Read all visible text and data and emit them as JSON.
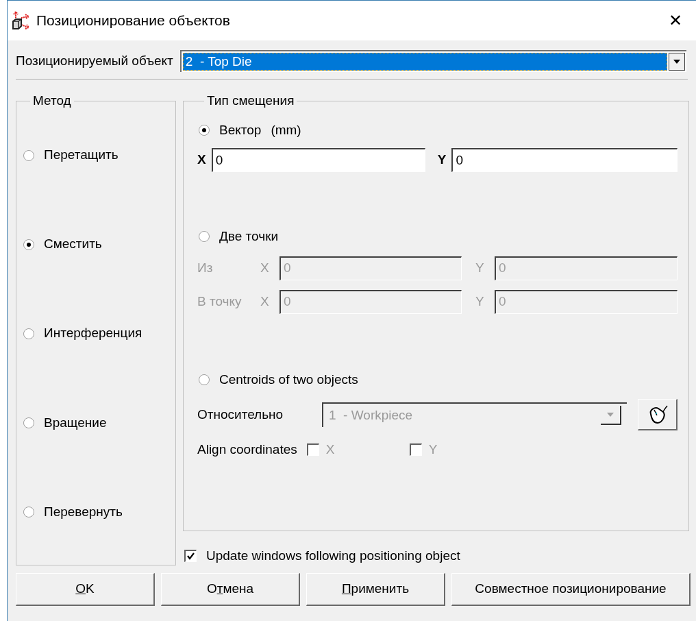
{
  "window": {
    "title": "Позиционирование объектов",
    "close": "✕"
  },
  "object_select": {
    "label": "Позиционируемый объект",
    "value": "2  - Top Die"
  },
  "method": {
    "title": "Метод",
    "options": [
      {
        "label": "Перетащить",
        "selected": false
      },
      {
        "label": "Сместить",
        "selected": true
      },
      {
        "label": "Интерференция",
        "selected": false
      },
      {
        "label": "Вращение",
        "selected": false
      },
      {
        "label": "Перевернуть",
        "selected": false
      }
    ]
  },
  "offset_type": {
    "title": "Тип смещения",
    "vector": {
      "label": "Вектор",
      "unit": "(mm)",
      "selected": true,
      "x_label": "X",
      "x_value": "0",
      "y_label": "Y",
      "y_value": "0"
    },
    "two_points": {
      "label": "Две точки",
      "selected": false,
      "disabled": true,
      "rows": [
        {
          "label": "Из",
          "x_label": "X",
          "x_value": "0",
          "y_label": "Y",
          "y_value": "0"
        },
        {
          "label": "В точку",
          "x_label": "X",
          "x_value": "0",
          "y_label": "Y",
          "y_value": "0"
        }
      ]
    },
    "centroids": {
      "label": "Centroids of two objects",
      "selected": false,
      "disabled": true,
      "relative_label": "Относительно",
      "relative_value": "1  - Workpiece",
      "align_label": "Align coordinates",
      "align": [
        {
          "label": "X",
          "checked": false
        },
        {
          "label": "Y",
          "checked": false
        }
      ]
    }
  },
  "update_checkbox": {
    "label": "Update windows following positioning object",
    "checked": true
  },
  "buttons": [
    {
      "key": "O",
      "after": "K"
    },
    {
      "before": "О",
      "key": "т",
      "after": "мена"
    },
    {
      "key": "П",
      "after": "рименить"
    },
    {
      "before": "Совместное позиционирование"
    }
  ]
}
